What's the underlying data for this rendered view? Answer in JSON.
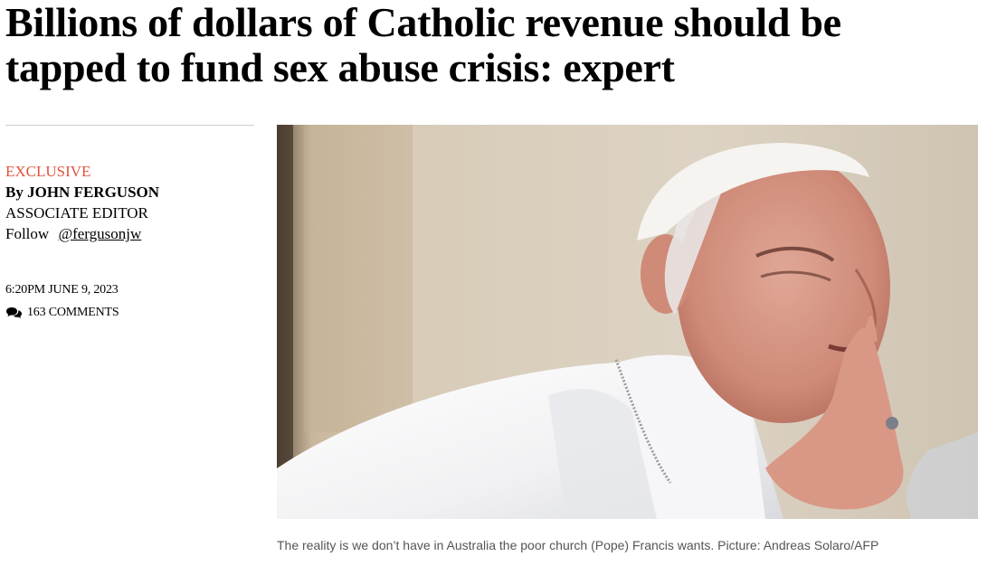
{
  "article": {
    "headline_line1": "Billions of dollars of Catholic revenue should be",
    "headline_line2": "tapped to fund sex abuse crisis: expert",
    "label": "EXCLUSIVE",
    "byline_prefix": "By",
    "author": "JOHN FERGUSON",
    "role": "ASSOCIATE EDITOR",
    "follow_label": "Follow",
    "handle": "@fergusonjw",
    "timestamp": "6:20PM JUNE 9, 2023",
    "comments_label": "163 COMMENTS",
    "caption": "The reality is we don’t have in Australia the poor church (Pope) Francis wants. Picture: Andreas Solaro/AFP"
  },
  "icons": {
    "comments": "speech-bubbles-icon"
  },
  "colors": {
    "accent": "#e5533d",
    "caption": "#555555",
    "divider": "#cfcfcf"
  }
}
